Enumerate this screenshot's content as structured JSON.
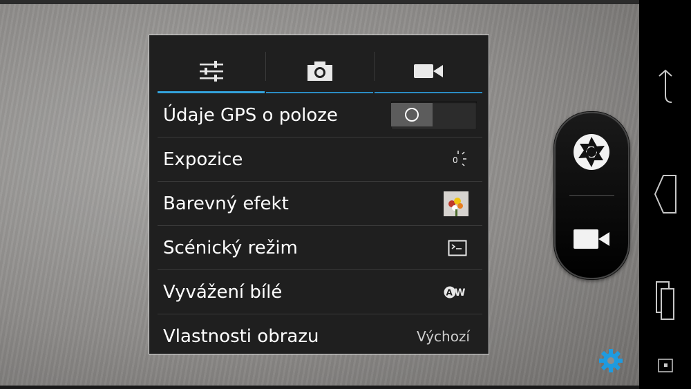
{
  "tabs": [
    {
      "name": "settings",
      "icon": "sliders-icon",
      "active": true
    },
    {
      "name": "photo",
      "icon": "camera-icon",
      "active": false
    },
    {
      "name": "video",
      "icon": "videocam-icon",
      "active": false
    }
  ],
  "settings": {
    "gps_label": "Údaje GPS o poloze",
    "gps_enabled": false,
    "exposure_label": "Expozice",
    "exposure_value": "0",
    "color_effect_label": "Barevný efekt",
    "scene_mode_label": "Scénický režim",
    "white_balance_label": "Vyvážení bílé",
    "white_balance_icon_text": "AW",
    "image_props_label": "Vlastnosti obrazu",
    "image_props_value": "Výchozí"
  },
  "colors": {
    "accent": "#33a3dc",
    "gear": "#1e9be0"
  }
}
